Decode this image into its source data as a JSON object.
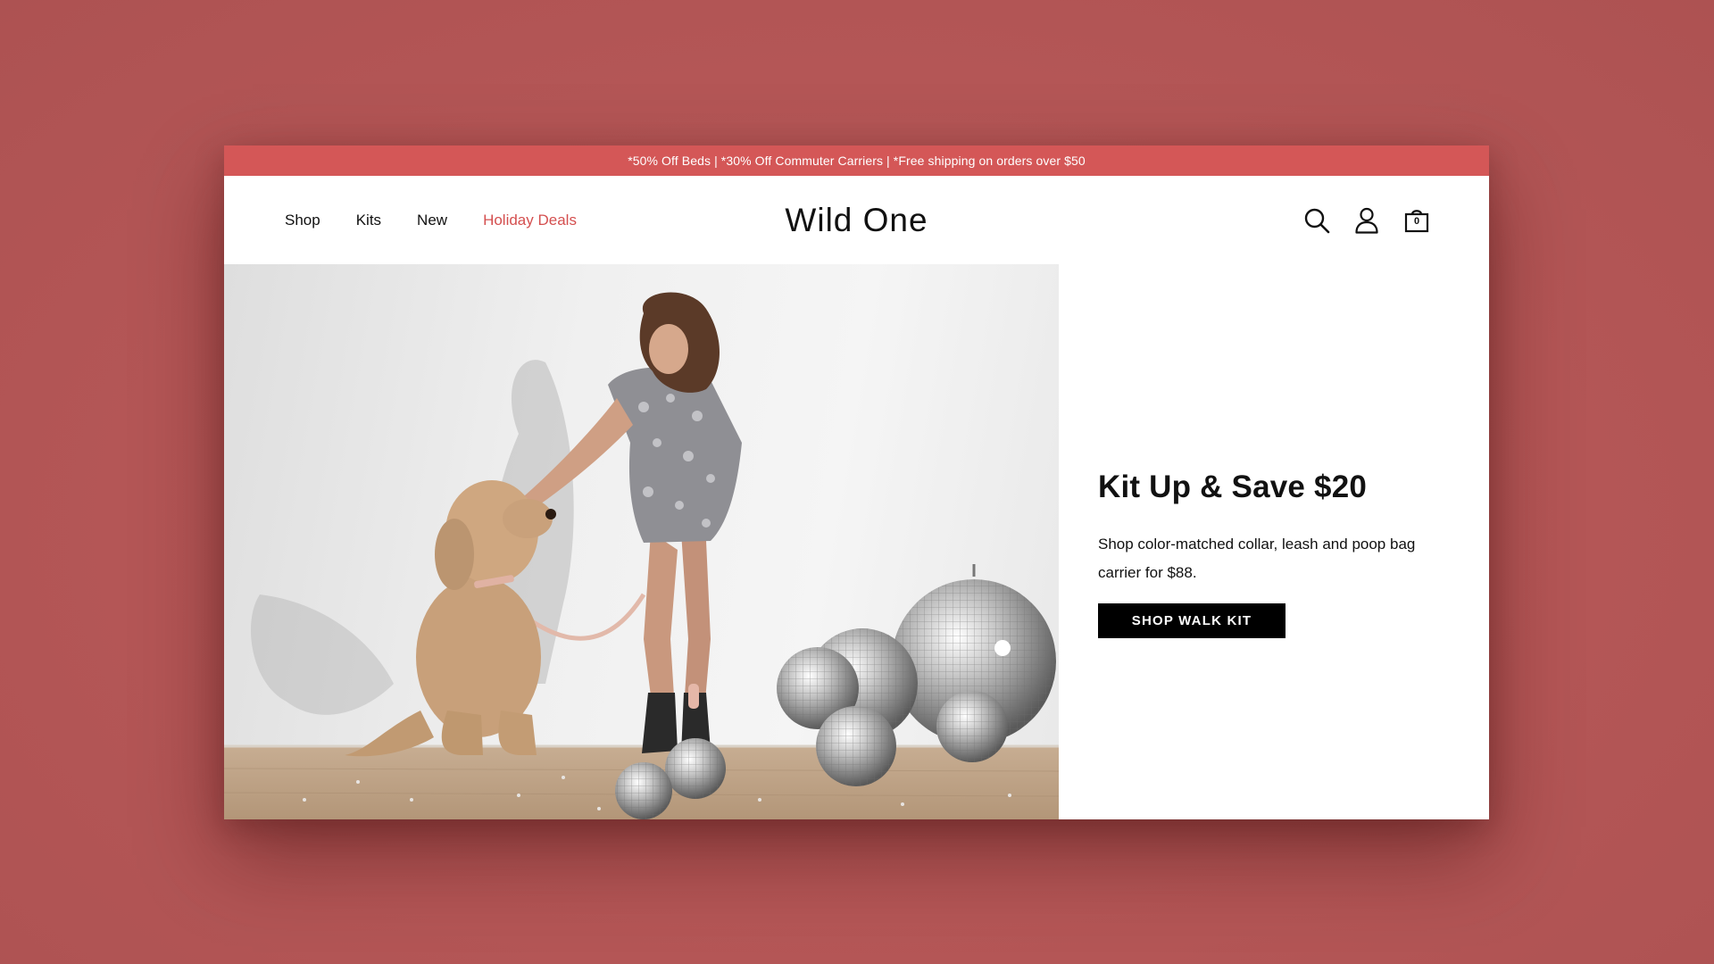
{
  "announcement": {
    "text": "*50% Off Beds | *30% Off Commuter Carriers | *Free shipping on orders over $50"
  },
  "nav": {
    "items": [
      {
        "label": "Shop"
      },
      {
        "label": "Kits"
      },
      {
        "label": "New"
      },
      {
        "label": "Holiday Deals"
      }
    ]
  },
  "brand": {
    "logo": "Wild One"
  },
  "header_icons": {
    "search": "search-icon",
    "account": "account-icon",
    "cart": "shopping-bag-icon",
    "cart_count": "0"
  },
  "hero": {
    "headline": "Kit Up & Save $20",
    "subtext": "Shop color-matched collar, leash and poop bag carrier for $88.",
    "cta_label": "SHOP WALK KIT"
  },
  "colors": {
    "background": "#b55858",
    "announcement_bar": "#d45757",
    "deal_link": "#d44f4f",
    "cta_background": "#000000"
  }
}
